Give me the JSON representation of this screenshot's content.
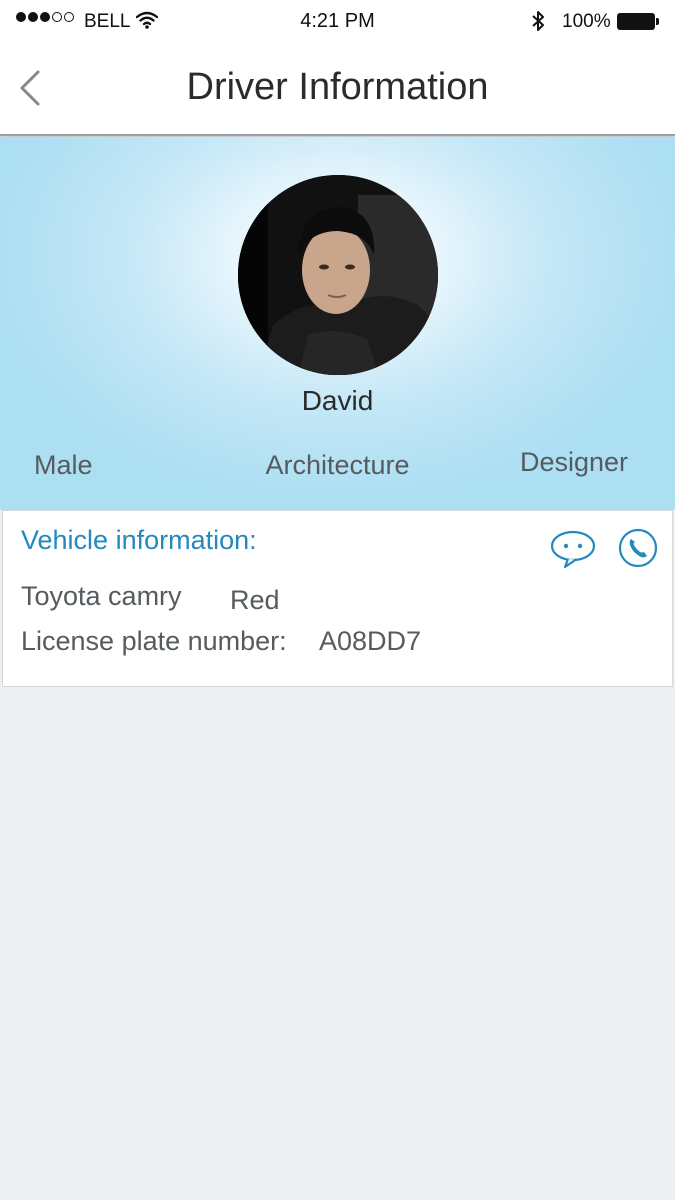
{
  "status_bar": {
    "carrier": "BELL",
    "time": "4:21 PM",
    "battery": "100%",
    "icons": [
      "signal-dots-icon",
      "wifi-icon",
      "bluetooth-icon",
      "battery-icon"
    ]
  },
  "nav": {
    "title": "Driver Information",
    "back_icon": "chevron-left-icon"
  },
  "driver": {
    "name": "David",
    "gender": "Male",
    "field": "Architecture",
    "occupation": "Designer"
  },
  "vehicle": {
    "heading": "Vehicle information:",
    "model": "Toyota camry",
    "color": "Red",
    "plate_label": "License plate number:",
    "plate_value": "A08DD7",
    "actions": [
      "message-icon",
      "phone-icon"
    ]
  },
  "colors": {
    "accent": "#2489bd",
    "header_bg": "#addff3",
    "page_bg": "#ecf0f1"
  }
}
